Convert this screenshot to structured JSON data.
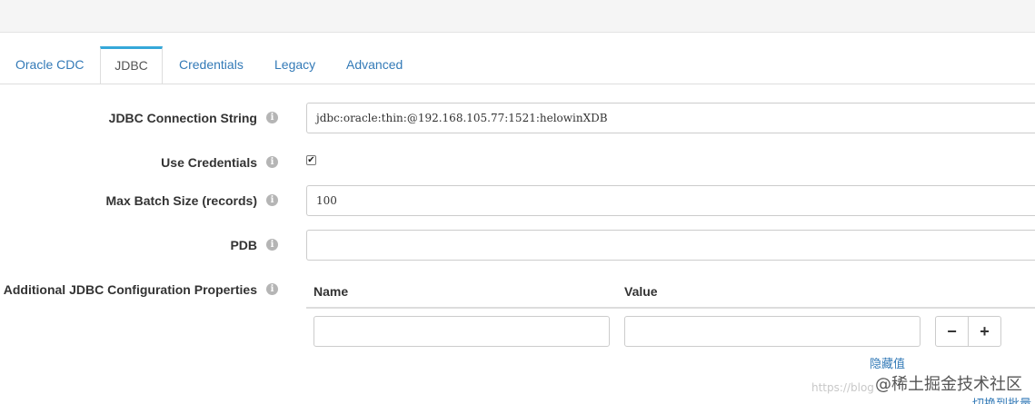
{
  "tabs": [
    {
      "label": "Oracle CDC",
      "active": false
    },
    {
      "label": "JDBC",
      "active": true
    },
    {
      "label": "Credentials",
      "active": false
    },
    {
      "label": "Legacy",
      "active": false
    },
    {
      "label": "Advanced",
      "active": false
    }
  ],
  "form": {
    "connection_string": {
      "label": "JDBC Connection String",
      "value": "jdbc:oracle:thin:@192.168.105.77:1521:helowinXDB"
    },
    "use_credentials": {
      "label": "Use Credentials",
      "checked": true,
      "check_glyph": "✔"
    },
    "max_batch": {
      "label": "Max Batch Size (records)",
      "value": "100"
    },
    "pdb": {
      "label": "PDB",
      "value": ""
    },
    "additional_props": {
      "label": "Additional JDBC Configuration Properties",
      "columns": {
        "name": "Name",
        "value": "Value"
      },
      "row": {
        "name": "",
        "value": ""
      },
      "remove_label": "−",
      "add_label": "+",
      "hide_link": "隐藏值"
    }
  },
  "info_glyph": "i",
  "watermark": "@稀土掘金技术社区",
  "url_watermark": "https://blog",
  "cut_link": "切换到批量"
}
